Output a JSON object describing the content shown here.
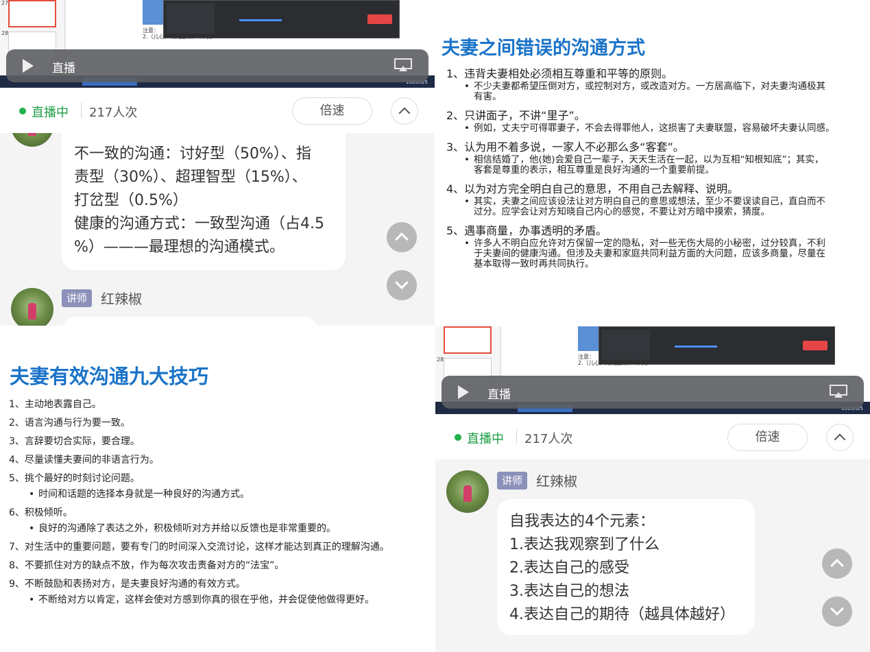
{
  "player": {
    "play_label": "直播",
    "status": "直播中",
    "viewers": "217人次",
    "speed_label": "倍速",
    "thumb_numbers": [
      "27",
      "28"
    ],
    "note_title": "注意：",
    "note_line2": "2.（儿心）为儿童青少年门诊",
    "taskbar_date": "2020/6/5"
  },
  "colors": {
    "live_green": "#1e9e45",
    "title_blue": "#1a73c8",
    "badge": "#8b91b9"
  },
  "chat_top": {
    "message_lines": [
      "不一致的沟通：讨好型（50%）、指",
      "责型（30%）、超理智型（15%）、",
      "打岔型（0.5%）",
      "健康的沟通方式：一致型沟通（占4.5",
      "%）———最理想的沟通模式。"
    ],
    "role": "讲师",
    "sender": "红辣椒"
  },
  "chat_bottom": {
    "role": "讲师",
    "sender": "红辣椒",
    "message_lines": [
      "自我表达的4个元素：",
      "1.表达我观察到了什么",
      "2.表达自己的感受",
      "3.表达自己的想法",
      "4.表达自己的期待（越具体越好）"
    ]
  },
  "slide_wrong": {
    "title": "夫妻之间错误的沟通方式",
    "items": [
      {
        "head": "1、违背夫妻相处必须相互尊重和平等的原则。",
        "sub": [
          "不少夫妻都希望压倒对方，或控制对方，或改造对方。一方居高临下，对夫妻沟通极其",
          "有害。"
        ]
      },
      {
        "head": "2、只讲面子，不讲“里子”。",
        "sub": [
          "例如，丈夫宁可得罪妻子，不会去得罪他人，这损害了夫妻联盟，容易破坏夫妻认同感。"
        ]
      },
      {
        "head": "3、认为用不着多说，一家人不必那么多“客套”。",
        "sub": [
          "相信结婚了，他(她)会爱自己一辈子，天天生活在一起，以为互相“知根知底”；其实，",
          "客套是尊重的表示，相互尊重是良好沟通的一个重要前提。"
        ]
      },
      {
        "head": "4、以为对方完全明白自己的意思，不用自己去解释、说明。",
        "sub": [
          "其实，夫妻之间应该设法让对方明白自己的意思或想法，至少不要误读自己，直白而不",
          "过分。应学会让对方知晓自己内心的感觉，不要让对方暗中摸索，猜度。"
        ]
      },
      {
        "head": "5、遇事商量，办事透明的矛盾。",
        "sub": [
          "许多人不明白应允许对方保留一定的隐私，对一些无伤大局的小秘密，过分较真，不利",
          "于夫妻间的健康沟通。但涉及夫妻和家庭共同利益方面的大问题，应该多商量，尽量在",
          "基本取得一致时再共同执行。"
        ]
      }
    ]
  },
  "slide_tips": {
    "title": "夫妻有效沟通九大技巧",
    "items": [
      {
        "head": "1、主动地表露自己。",
        "sub": []
      },
      {
        "head": "2、语言沟通与行为要一致。",
        "sub": []
      },
      {
        "head": "3、言辞要切合实际，要合理。",
        "sub": []
      },
      {
        "head": "4、尽量读懂夫妻间的非语言行为。",
        "sub": []
      },
      {
        "head": "5、挑个最好的时刻讨论问题。",
        "sub": [
          "时间和话题的选择本身就是一种良好的沟通方式。"
        ]
      },
      {
        "head": "6、积极倾听。",
        "sub": [
          "良好的沟通除了表达之外，积极倾听对方并给以反馈也是非常重要的。"
        ]
      },
      {
        "head": "7、对生活中的重要问题，要有专门的时间深入交流讨论，这样才能达到真正的理解沟通。",
        "sub": []
      },
      {
        "head": "8、不要抓住对方的缺点不放，作为每次攻击责备对方的“法宝”。",
        "sub": []
      },
      {
        "head": "9、不断鼓励和表扬对方，是夫妻良好沟通的有效方式。",
        "sub": [
          "不断给对方以肯定，这样会使对方感到你真的很在乎他，并会促使他做得更好。"
        ]
      }
    ]
  }
}
